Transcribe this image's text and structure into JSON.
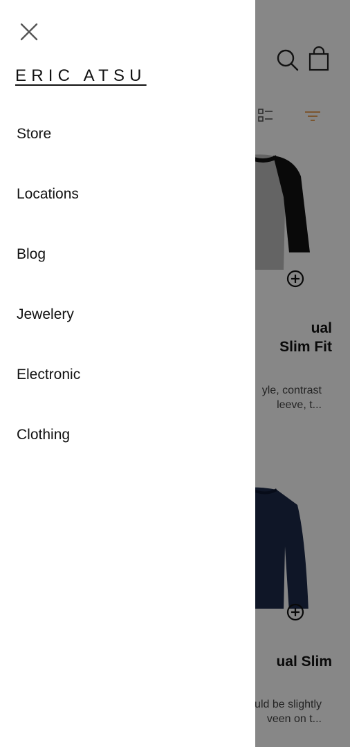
{
  "brand": {
    "name": "ERIC ATSU"
  },
  "drawer": {
    "menu": [
      {
        "label": "Store"
      },
      {
        "label": "Locations"
      },
      {
        "label": "Blog"
      },
      {
        "label": "Jewelery"
      },
      {
        "label": "Electronic"
      },
      {
        "label": "Clothing"
      }
    ]
  },
  "header_icons": [
    "search-icon",
    "shopping-bag-icon",
    "list-view-icon",
    "filter-icon"
  ],
  "products": [
    {
      "title_visible": "ual\nSlim Fit",
      "desc_visible": "yle, contrast\nleeve, t..."
    },
    {
      "title_visible": "ual Slim",
      "desc_visible": "uld be slightly\nveen on t..."
    }
  ],
  "colors": {
    "accent": "#e8a35c",
    "scrim": "#000000",
    "drawer_bg": "#ffffff"
  }
}
